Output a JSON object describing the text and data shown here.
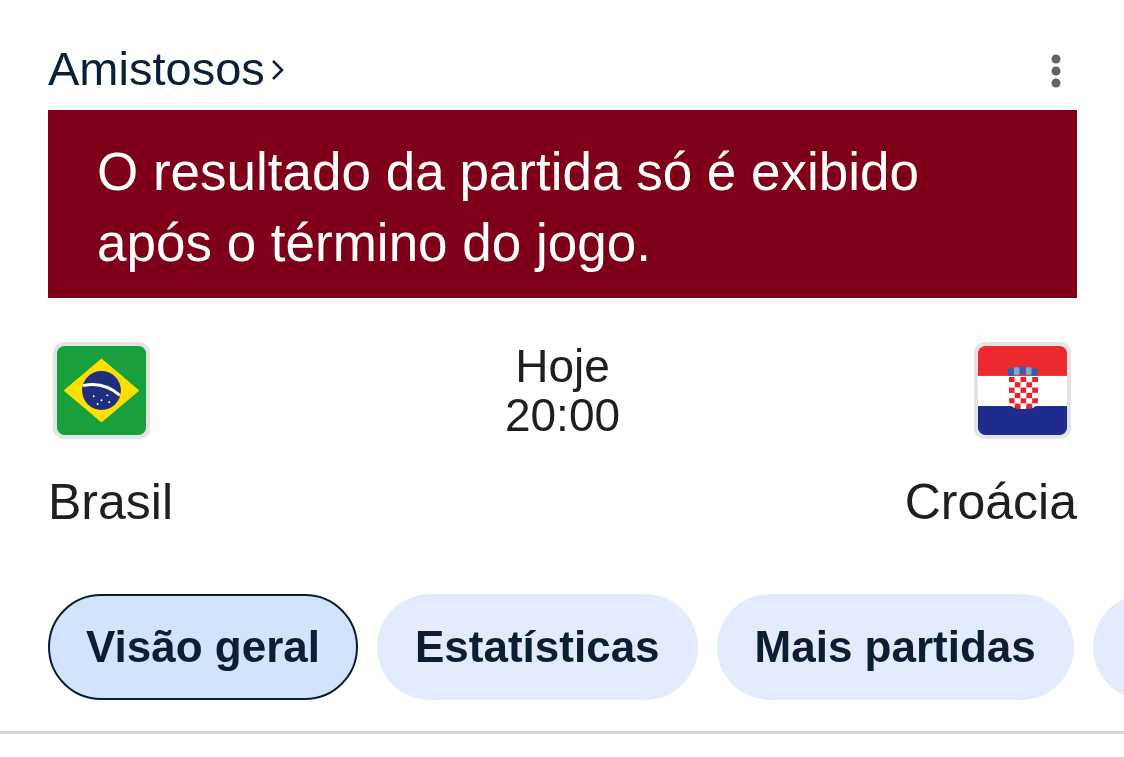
{
  "header": {
    "competition": "Amistosos"
  },
  "notice": {
    "text": "O resultado da partida só é exibido após o término do jogo."
  },
  "match": {
    "teams": [
      {
        "name": "Brasil"
      },
      {
        "name": "Croácia"
      }
    ],
    "day": "Hoje",
    "time": "20:00"
  },
  "tabs": [
    {
      "label": "Visão geral",
      "selected": true
    },
    {
      "label": "Estatísticas",
      "selected": false
    },
    {
      "label": "Mais partidas",
      "selected": false
    }
  ]
}
